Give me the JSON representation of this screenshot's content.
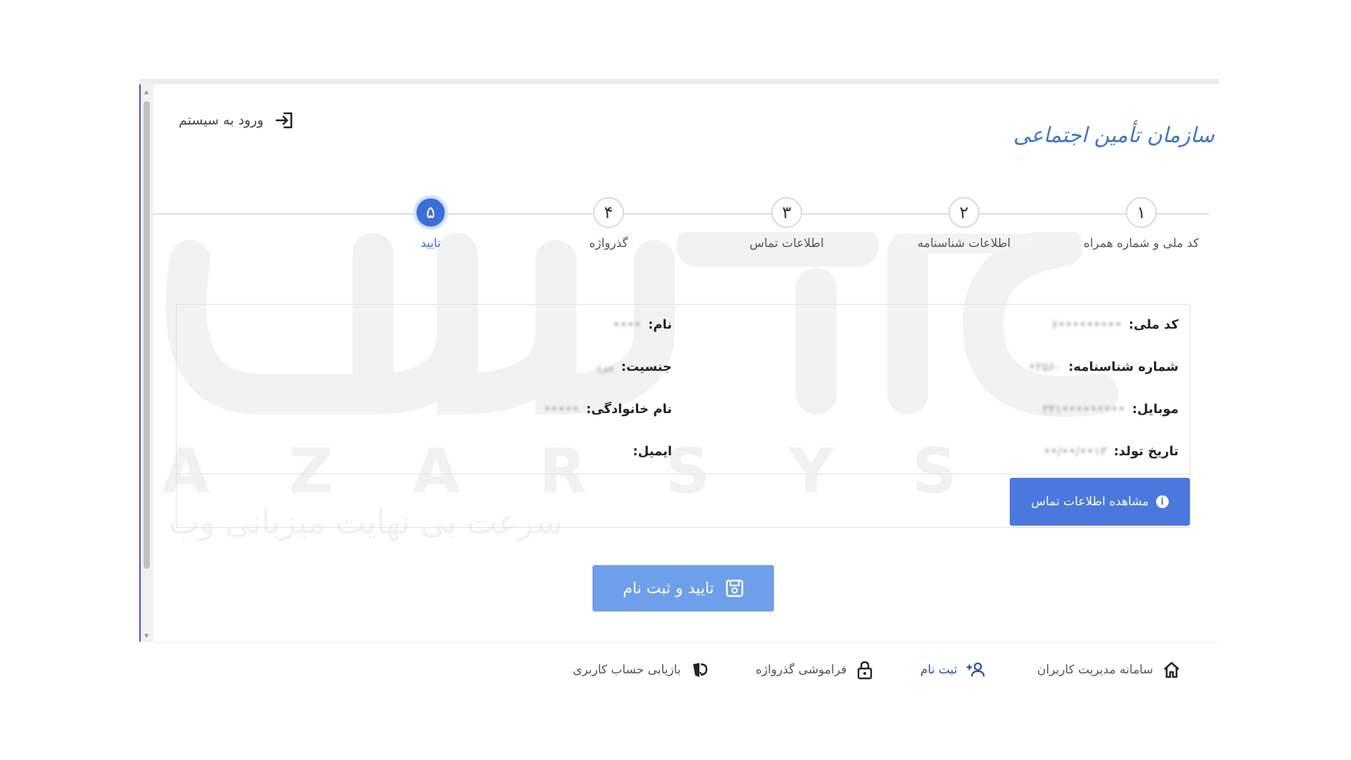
{
  "header": {
    "logo_text": "سازمان تأمین اجتماعی",
    "login_label": "ورود به سیستم"
  },
  "stepper": {
    "active_index": 5,
    "steps": [
      {
        "number": "۱",
        "label": "کد ملی و شماره همراه"
      },
      {
        "number": "۲",
        "label": "اطلاعات شناسنامه"
      },
      {
        "number": "۳",
        "label": "اطلاعات تماس"
      },
      {
        "number": "۴",
        "label": "گذرواژه"
      },
      {
        "number": "۵",
        "label": "تایید"
      }
    ]
  },
  "watermark": {
    "latin": [
      "A",
      "Z",
      "A",
      "R",
      "S",
      "Y",
      "S"
    ],
    "tagline": "سرعت بی نهایت میزبانی وب"
  },
  "summary": {
    "national_code": {
      "label": "کد ملی:",
      "value": "•••••••••۶"
    },
    "birth_cert_no": {
      "label": "شماره شناسنامه:",
      "value": "۲۵۶۰•"
    },
    "mobile": {
      "label": "موبایل:",
      "value": "•••••••••۳۴۱"
    },
    "birth_date": {
      "label": "تاریخ تولد:",
      "value": "۱۳••/••/••"
    },
    "first_name": {
      "label": "نام:",
      "value": "••••"
    },
    "gender": {
      "label": "جنسیت:",
      "value": "مرد"
    },
    "last_name": {
      "label": "نام خانوادگی:",
      "value": "•••••"
    },
    "email": {
      "label": "ایمیل:",
      "value": ""
    },
    "contact_button": "مشاهده اطلاعات تماس"
  },
  "actions": {
    "submit_label": "تایید و ثبت نام"
  },
  "footer": {
    "home": "سامانه مدیریت کاربران",
    "register": "ثبت نام",
    "forgot_password": "فراموشی گذرواژه",
    "recover_account": "بازیابی حساب کاربری"
  },
  "colors": {
    "primary": "#3b6fd8",
    "button": "#4a78dc",
    "submit": "#6f9fea",
    "logo": "#3d75c9"
  }
}
